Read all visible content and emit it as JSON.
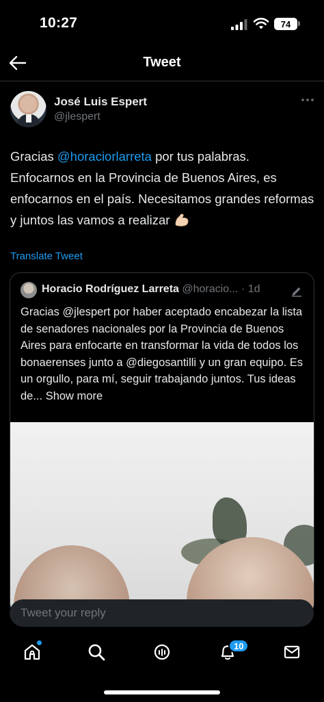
{
  "status_bar": {
    "time": "10:27",
    "battery": "74"
  },
  "header": {
    "title": "Tweet"
  },
  "tweet": {
    "author_name": "José Luis Espert",
    "author_handle": "@jlespert",
    "text_before_mention": "Gracias ",
    "mention": "@horaciorlarreta",
    "text_after_mention": " por tus palabras. Enfocarnos en la Provincia de Buenos Aires, es enfocarnos en el país. Necesitamos grandes reformas y juntos las vamos a realizar",
    "emoji": "flexed-biceps",
    "translate_label": "Translate Tweet"
  },
  "quote": {
    "author_name": "Horacio Rodríguez Larreta",
    "author_handle": "@horacio...",
    "time": "1d",
    "text_part1": "Gracias ",
    "mention1": "@jlespert",
    "text_part2": " por haber aceptado encabezar la lista de senadores nacionales por la Provincia de Buenos Aires para enfocarte en transformar la vida de todos los bonaerenses junto a ",
    "mention2": "@diegosantilli",
    "text_part3": " y un gran equipo. Es un orgullo, para mí, seguir trabajando juntos. Tus ideas de...",
    "show_more": "Show more"
  },
  "reply": {
    "placeholder": "Tweet your reply"
  },
  "tab_bar": {
    "notifications_count": "10"
  },
  "colors": {
    "accent": "#1d9bf0",
    "background": "#000000",
    "text": "#e7e9ea",
    "muted": "#71767b"
  }
}
